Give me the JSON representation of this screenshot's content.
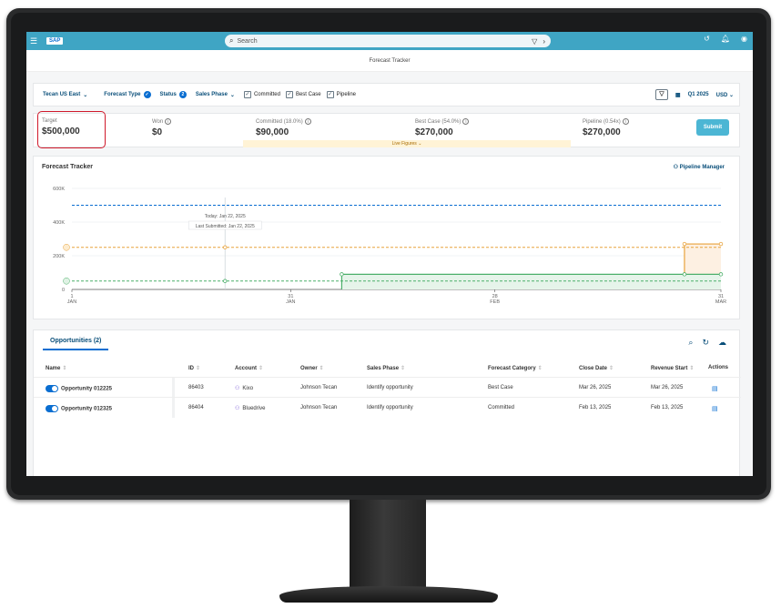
{
  "shell": {
    "menu_icon": "☰",
    "logo": "SAP",
    "search_placeholder": "Search",
    "icons": [
      "history-icon",
      "bell-icon",
      "user-icon"
    ]
  },
  "page_title": "Forecast Tracker",
  "filters": {
    "region": "Tecan US East",
    "forecast_type": "Forecast Type",
    "status": "Status",
    "status_count": "2",
    "sales_phase": "Sales Phase",
    "committed": "Committed",
    "best_case": "Best Case",
    "pipeline": "Pipeline",
    "period": "Q1 2025",
    "currency": "USD"
  },
  "kpis": {
    "target_label": "Target",
    "target_value": "$500,000",
    "won_label": "Won",
    "won_value": "$0",
    "committed_label": "Committed",
    "committed_pct": "(18.0%)",
    "committed_value": "$90,000",
    "best_case_label": "Best Case",
    "best_case_pct": "(54.0%)",
    "best_case_value": "$270,000",
    "pipeline_label": "Pipeline",
    "pipeline_ratio": "(0.54x)",
    "pipeline_value": "$270,000",
    "live_figures": "Live Figures",
    "submit_label": "Submit"
  },
  "chart": {
    "title": "Forecast Tracker",
    "pipeline_manager": "Pipeline Manager",
    "today_label": "Today: Jan 22, 2025",
    "last_submitted_label": "Last Submitted: Jan 22, 2025",
    "y_ticks": [
      "600K",
      "400K",
      "200K",
      "0"
    ],
    "x_ticks": [
      {
        "day": "1",
        "month": "JAN"
      },
      {
        "day": "31",
        "month": "JAN"
      },
      {
        "day": "28",
        "month": "FEB"
      },
      {
        "day": "31",
        "month": "MAR"
      }
    ]
  },
  "chart_data": {
    "type": "line",
    "title": "Forecast Tracker",
    "ylim": [
      0,
      600000
    ],
    "y_ticks": [
      0,
      200000,
      400000,
      600000
    ],
    "x_range": [
      "2025-01-01",
      "2025-03-31"
    ],
    "x_ticks": [
      "2025-01-01",
      "2025-01-31",
      "2025-02-28",
      "2025-03-31"
    ],
    "series": [
      {
        "values": [
          [
            "2025-01-01",
            500000
          ],
          [
            "2025-03-31",
            500000
          ]
        ],
        "color": "#0a6ed1",
        "style": "dashed"
      },
      {
        "values": [
          [
            "2025-01-01",
            250000
          ],
          [
            "2025-03-31",
            250000
          ]
        ],
        "color": "#e8a33c",
        "style": "dashed"
      },
      {
        "values": [
          [
            "2025-01-01",
            50000
          ],
          [
            "2025-03-31",
            50000
          ]
        ],
        "color": "#4caf6a",
        "style": "dashed"
      },
      {
        "values": [
          [
            "2025-02-07",
            0
          ],
          [
            "2025-02-07",
            90000
          ],
          [
            "2025-03-26",
            90000
          ],
          [
            "2025-03-31",
            90000
          ]
        ],
        "color": "#4caf6a",
        "style": "solid"
      },
      {
        "values": [
          [
            "2025-03-26",
            90000
          ],
          [
            "2025-03-26",
            270000
          ],
          [
            "2025-03-31",
            270000
          ]
        ],
        "color": "#e8a33c",
        "style": "solid"
      }
    ]
  },
  "table": {
    "tab_label": "Opportunities (2)",
    "columns": [
      "Name",
      "ID",
      "Account",
      "Owner",
      "Sales Phase",
      "Forecast Category",
      "Close Date",
      "Revenue Start",
      "Actions"
    ],
    "rows": [
      {
        "name": "Opportunity 012225",
        "id": "86403",
        "account": "Kixo",
        "owner": "Johnson Tecan",
        "phase": "Identify opportunity",
        "category": "Best Case",
        "close": "Mar 26, 2025",
        "revenue": "Mar 26, 2025"
      },
      {
        "name": "Opportunity 012325",
        "id": "86404",
        "account": "Bluedrive",
        "owner": "Johnson Tecan",
        "phase": "Identify opportunity",
        "category": "Committed",
        "close": "Feb 13, 2025",
        "revenue": "Feb 13, 2025"
      }
    ]
  }
}
